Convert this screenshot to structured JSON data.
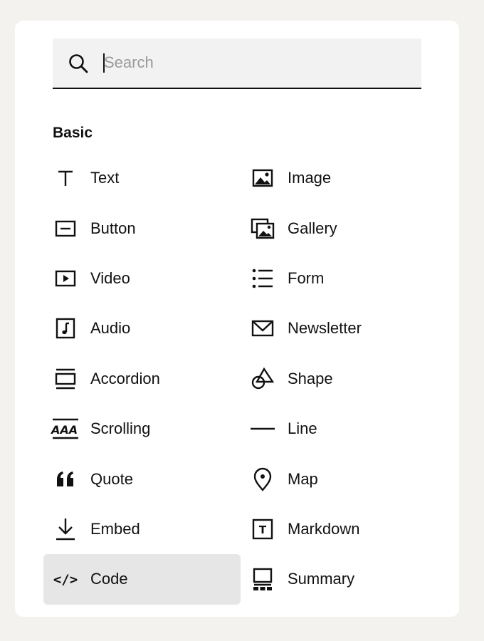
{
  "search": {
    "placeholder": "Search",
    "value": ""
  },
  "section": {
    "title": "Basic"
  },
  "items": [
    {
      "label": "Text",
      "icon": "text-icon"
    },
    {
      "label": "Image",
      "icon": "image-icon"
    },
    {
      "label": "Button",
      "icon": "button-icon"
    },
    {
      "label": "Gallery",
      "icon": "gallery-icon"
    },
    {
      "label": "Video",
      "icon": "video-icon"
    },
    {
      "label": "Form",
      "icon": "form-icon"
    },
    {
      "label": "Audio",
      "icon": "audio-icon"
    },
    {
      "label": "Newsletter",
      "icon": "newsletter-icon"
    },
    {
      "label": "Accordion",
      "icon": "accordion-icon"
    },
    {
      "label": "Shape",
      "icon": "shape-icon"
    },
    {
      "label": "Scrolling",
      "icon": "scrolling-icon",
      "icon_text": "AAA"
    },
    {
      "label": "Line",
      "icon": "line-icon"
    },
    {
      "label": "Quote",
      "icon": "quote-icon"
    },
    {
      "label": "Map",
      "icon": "map-pin-icon"
    },
    {
      "label": "Embed",
      "icon": "embed-download-icon"
    },
    {
      "label": "Markdown",
      "icon": "markdown-icon",
      "icon_text": "T"
    },
    {
      "label": "Code",
      "icon": "code-icon",
      "icon_text": "</>",
      "selected": true
    },
    {
      "label": "Summary",
      "icon": "summary-icon"
    }
  ],
  "colors": {
    "background": "#f3f2ee",
    "panel": "#ffffff",
    "search_bg": "#f2f2f2",
    "selected_bg": "#e6e6e6",
    "text": "#111111",
    "placeholder": "#9a9a9a"
  }
}
